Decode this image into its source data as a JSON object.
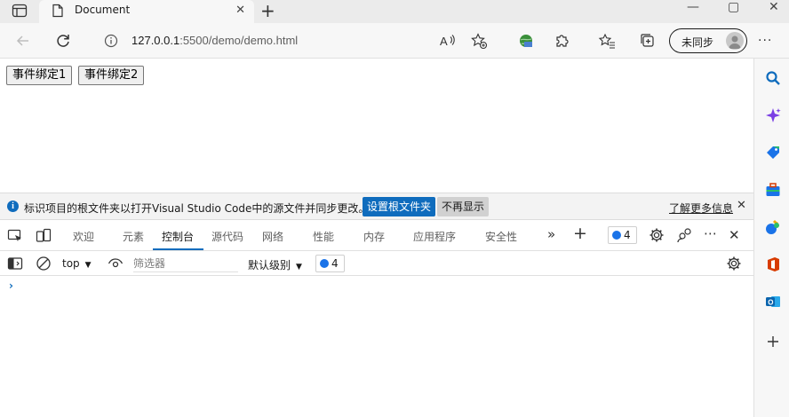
{
  "browser": {
    "tab_title": "Document",
    "new_tab_glyph": "+",
    "close_glyph": "✕",
    "url_host": "127.0.0.1",
    "url_path": ":5500/demo/demo.html",
    "profile_label": "未同步",
    "more_glyph": "···",
    "window_controls": [
      "—",
      "▢",
      "✕"
    ]
  },
  "page": {
    "buttons": [
      "事件绑定1",
      "事件绑定2"
    ]
  },
  "infobar": {
    "icon_glyph": "i",
    "message": "标识项目的根文件夹以打开Visual Studio Code中的源文件并同步更改。",
    "primary_button": "设置根文件夹",
    "secondary_button": "不再显示",
    "link": "了解更多信息",
    "close_glyph": "✕"
  },
  "devtools": {
    "tabs": [
      "欢迎",
      "元素",
      "控制台",
      "源代码",
      "网络",
      "性能",
      "内存",
      "应用程序",
      "安全性"
    ],
    "active_tab": "控制台",
    "more_tabs_glyph": "»",
    "add_tab_glyph": "+",
    "issues_count": "4",
    "more_glyph": "⋯",
    "close_glyph": "✕",
    "toolbar": {
      "context": "top",
      "filter_placeholder": "筛选器",
      "level": "默认级别",
      "issues_count": "4",
      "caret": "▼"
    },
    "prompt": "›"
  },
  "colors": {
    "accent": "#0f6cbd",
    "badge_blue": "#1a73e8"
  }
}
